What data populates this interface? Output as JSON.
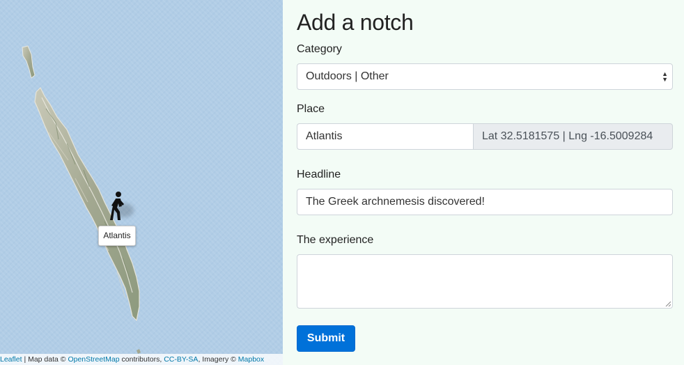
{
  "map": {
    "marker_icon": "hiker-icon",
    "tooltip_label": "Atlantis",
    "attribution": {
      "leaflet": "Leaflet",
      "sep1": " | Map data © ",
      "osm": "OpenStreetMap",
      "sep2": " contributors, ",
      "license": "CC-BY-SA",
      "sep3": ", Imagery © ",
      "mapbox": "Mapbox"
    }
  },
  "form": {
    "title": "Add a notch",
    "category": {
      "label": "Category",
      "selected": "Outdoors | Other"
    },
    "place": {
      "label": "Place",
      "value": "Atlantis",
      "coordinates": "Lat 32.5181575 | Lng -16.5009284"
    },
    "headline": {
      "label": "Headline",
      "value": "The Greek archnemesis discovered!"
    },
    "experience": {
      "label": "The experience",
      "value": ""
    },
    "submit_label": "Submit"
  },
  "colors": {
    "panel_background": "#f3fcf6",
    "water": "#b1cde6",
    "land": "#a9ad96",
    "primary_button": "#0071d9",
    "link": "#0078a8"
  }
}
